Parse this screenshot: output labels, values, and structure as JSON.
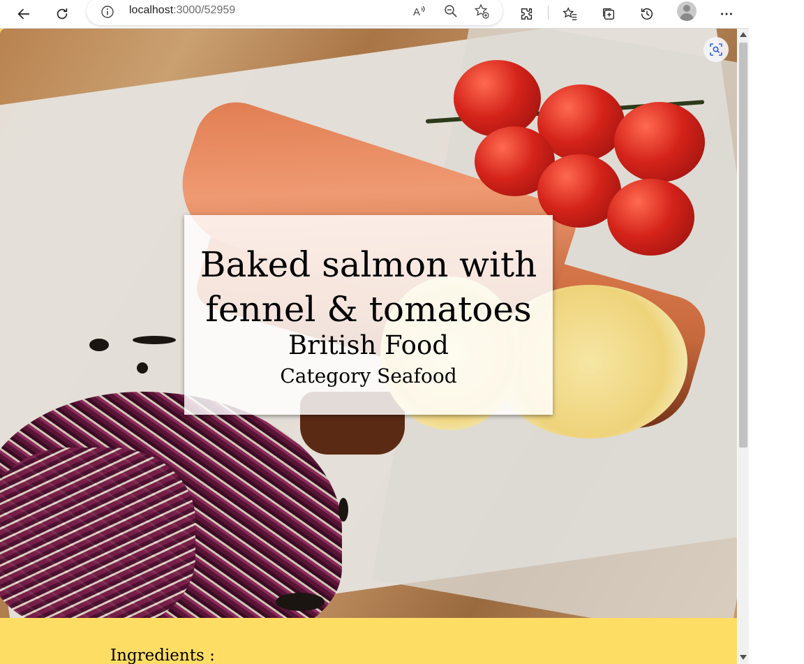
{
  "browser": {
    "url_host": "localhost",
    "url_path": ":3000/52959"
  },
  "meal": {
    "title": "Baked salmon with fennel & tomatoes",
    "area": "British Food",
    "category": "Category Seafood"
  },
  "sections": {
    "ingredients_heading": "Ingredients :"
  },
  "colors": {
    "page_background": "#fedd64",
    "title_box_background": "#ffffff"
  },
  "icons": [
    "back-arrow-icon",
    "refresh-icon",
    "info-icon",
    "read-aloud-icon",
    "zoom-out-icon",
    "add-favorite-icon",
    "extensions-icon",
    "favorites-icon",
    "collections-icon",
    "history-icon",
    "profile-icon",
    "more-menu-icon",
    "visual-search-icon"
  ]
}
